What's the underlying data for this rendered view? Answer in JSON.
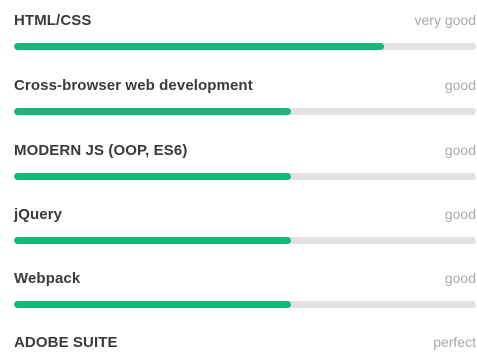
{
  "colors": {
    "accent": "#16b777",
    "track": "#e2e2e2",
    "name_text": "#3a3a3a",
    "level_text": "#a9a9a9"
  },
  "skills": [
    {
      "name": "HTML/CSS",
      "level": "very good",
      "progress": 0.8
    },
    {
      "name": "Cross-browser web development",
      "level": "good",
      "progress": 0.6
    },
    {
      "name": "MODERN JS (OOP, ES6)",
      "level": "good",
      "progress": 0.6
    },
    {
      "name": "jQuery",
      "level": "good",
      "progress": 0.6
    },
    {
      "name": "Webpack",
      "level": "good",
      "progress": 0.6
    },
    {
      "name": "ADOBE SUITE",
      "level": "perfect"
    }
  ]
}
